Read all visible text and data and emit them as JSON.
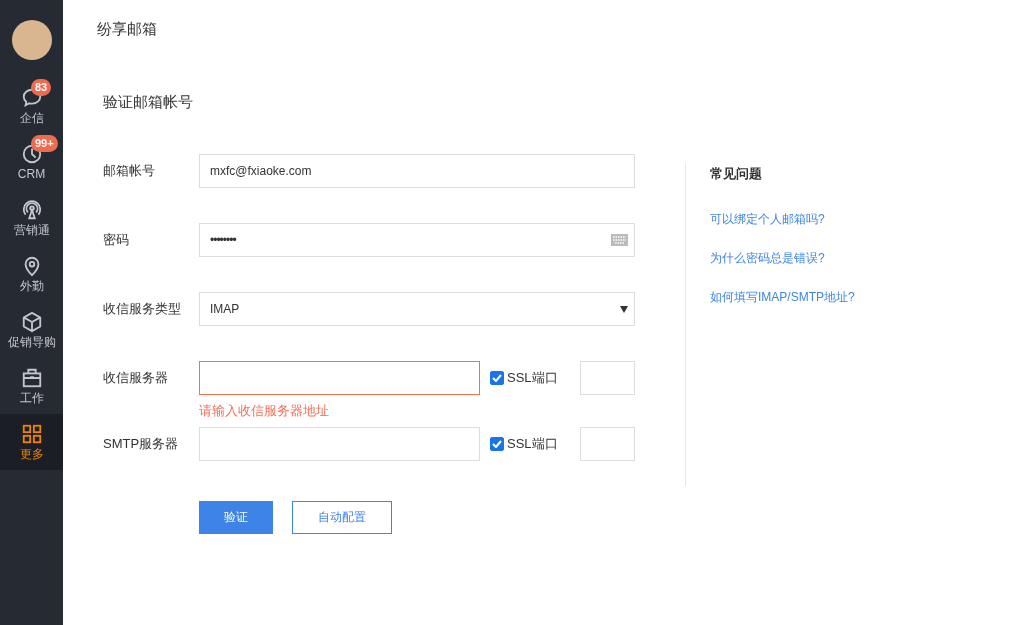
{
  "sidebar": {
    "items": [
      {
        "label": "企信",
        "badge": "83",
        "selected": false
      },
      {
        "label": "CRM",
        "badge": "99+",
        "selected": false
      },
      {
        "label": "营销通",
        "selected": false
      },
      {
        "label": "外勤",
        "selected": false
      },
      {
        "label": "促销导购",
        "selected": false
      },
      {
        "label": "工作",
        "selected": false
      },
      {
        "label": "更多",
        "selected": true
      }
    ]
  },
  "page_title": "纷享邮箱",
  "section_title": "验证邮箱帐号",
  "form": {
    "fields": [
      {
        "kind": "text",
        "label": "邮箱帐号",
        "value": "mxfc@fxiaoke.com"
      },
      {
        "kind": "password",
        "label": "密码",
        "value": "••••••••"
      },
      {
        "kind": "select",
        "label": "收信服务类型",
        "value": "IMAP"
      },
      {
        "kind": "server",
        "label": "收信服务器",
        "invalid": true,
        "error": "请输入收信服务器地址",
        "ssl_label": "SSL端口",
        "ssl_checked": true
      },
      {
        "kind": "server",
        "label": "SMTP服务器",
        "invalid": false,
        "ssl_label": "SSL端口",
        "ssl_checked": true
      }
    ],
    "buttons": [
      {
        "label": "验证",
        "primary": true
      },
      {
        "label": "自动配置",
        "primary": false
      }
    ]
  },
  "faq": {
    "title": "常见问题",
    "links": [
      "可以绑定个人邮箱吗?",
      "为什么密码总是错误?",
      "如何填写IMAP/SMTP地址?"
    ]
  }
}
